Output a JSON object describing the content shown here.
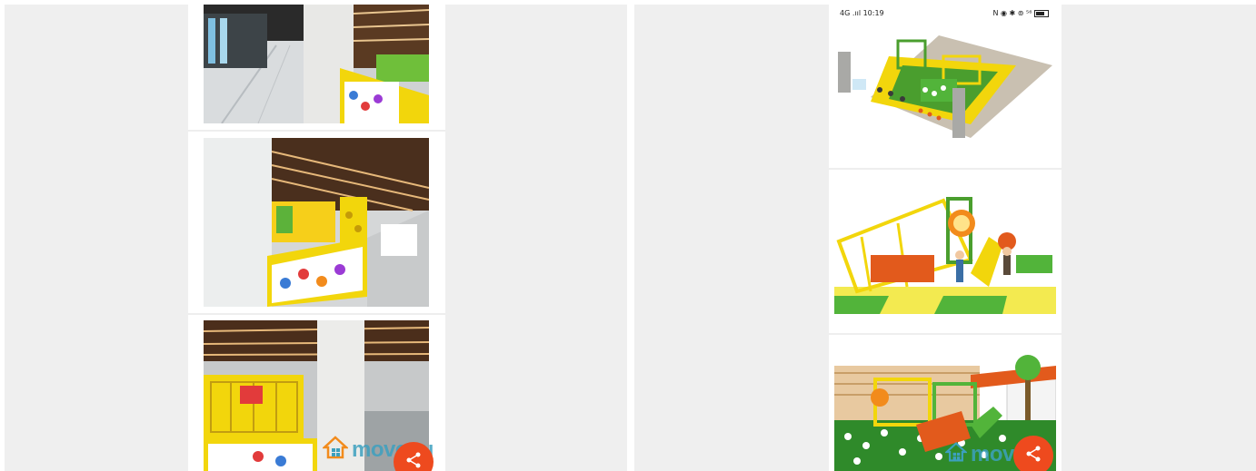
{
  "status_bar": {
    "left_text": "4G .ııl 10:19",
    "right_text": "N ◉ ✱ ⊚ ⁵⁶",
    "battery_icon": "battery-icon"
  },
  "watermarks": {
    "left": "move.ru",
    "right": "move.ru"
  },
  "icons": {
    "house": "house-icon",
    "share": "share-icon"
  },
  "colors": {
    "accent_orange": "#ee4a1e",
    "brand_blue": "#3ca0be",
    "yellow": "#f2d60c",
    "green": "#52b43a"
  }
}
